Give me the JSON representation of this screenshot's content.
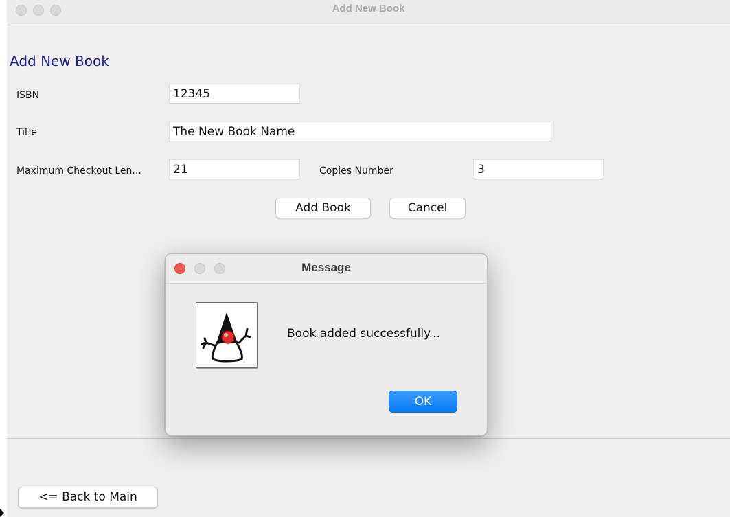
{
  "window": {
    "title": "Add New Book"
  },
  "form": {
    "heading": "Add New Book",
    "isbn_label": "ISBN",
    "isbn_value": "12345",
    "title_label": "Title",
    "title_value": "The New Book Name",
    "max_checkout_label": "Maximum Checkout Len...",
    "max_checkout_value": "21",
    "copies_label": "Copies Number",
    "copies_value": "3",
    "add_button": "Add Book",
    "cancel_button": "Cancel"
  },
  "footer": {
    "back_button": "<= Back to Main"
  },
  "dialog": {
    "title": "Message",
    "message": "Book added successfully...",
    "ok_button": "OK",
    "icon": "java-duke-icon"
  },
  "colors": {
    "heading": "#1d1f8f",
    "ok_button": "#1a8cff",
    "close_light": "#ee5a52",
    "window_bg": "#efefef"
  }
}
